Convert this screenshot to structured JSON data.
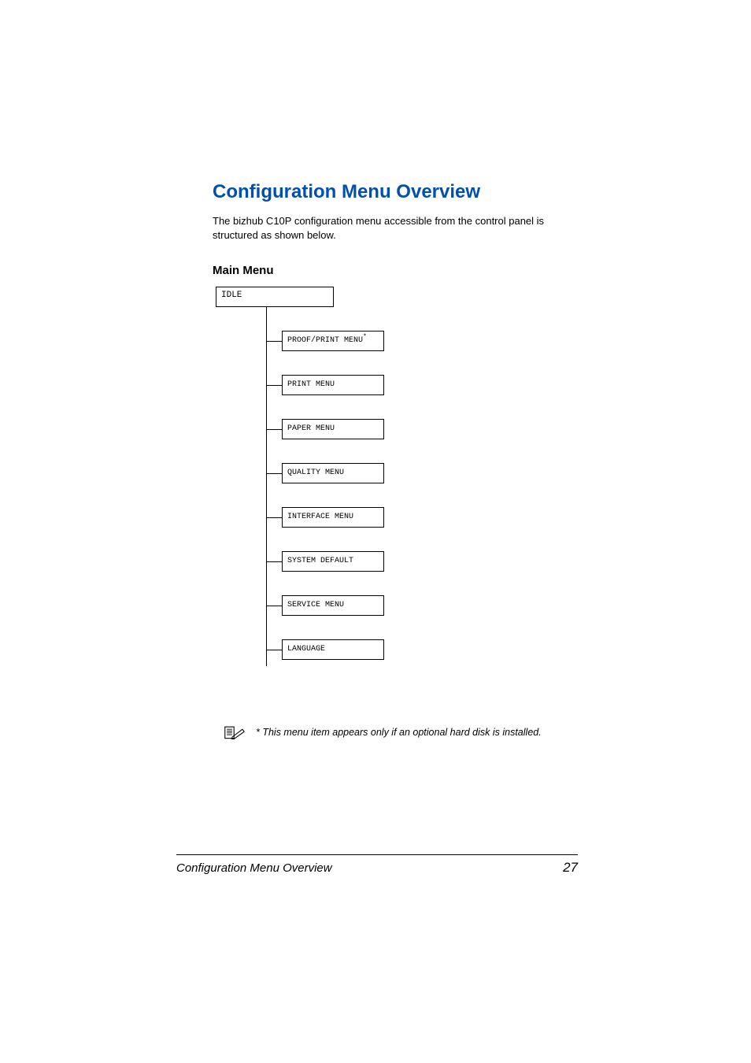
{
  "heading": "Configuration Menu Overview",
  "intro": "The bizhub C10P configuration menu accessible from the control panel is structured as shown below.",
  "subheading": "Main Menu",
  "diagram": {
    "root": "IDLE",
    "items": [
      "PROOF/PRINT MENU",
      "PRINT MENU",
      "PAPER MENU",
      "QUALITY MENU",
      "INTERFACE MENU",
      "SYSTEM DEFAULT",
      "SERVICE MENU",
      "LANGUAGE"
    ],
    "first_item_has_asterisk": true
  },
  "note": "* This menu item appears only if an optional hard disk is installed.",
  "footer": {
    "title": "Configuration Menu Overview",
    "page": "27"
  }
}
